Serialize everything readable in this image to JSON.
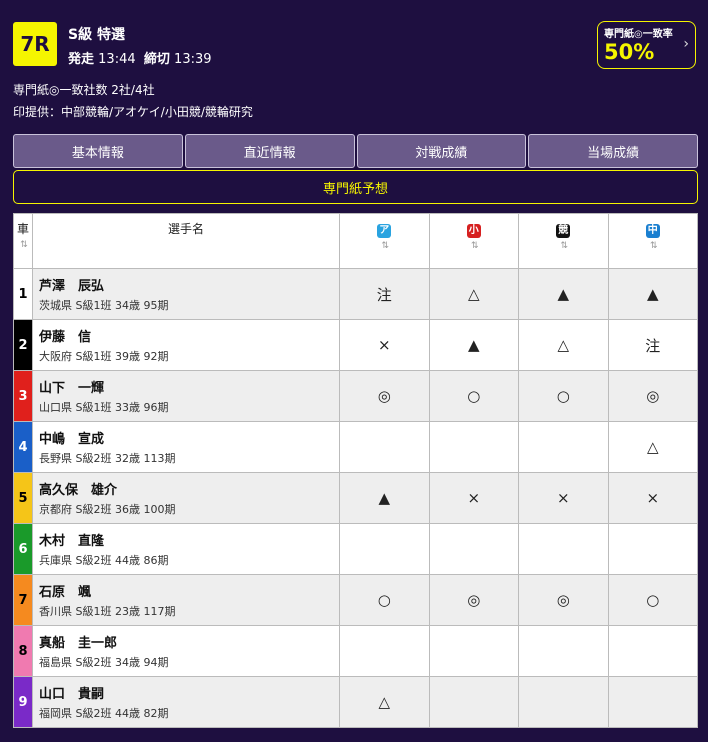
{
  "race": {
    "number": "7R",
    "class": "S級 特選",
    "start_label": "発走",
    "start_time": "13:44",
    "close_label": "締切",
    "close_time": "13:39"
  },
  "agreement": {
    "label": "専門紙◎一致率",
    "value": "50%"
  },
  "info": {
    "count": "専門紙◎一致社数 2社/4社",
    "sources": "印提供：中部競輪/アオケイ/小田競/競輪研究"
  },
  "tabs": [
    "基本情報",
    "直近情報",
    "対戦成績",
    "当場成績"
  ],
  "active_tab": "専門紙予想",
  "table": {
    "col_car": "車",
    "col_name": "選手名",
    "publishers": [
      {
        "icon_text": "ア",
        "color": "#29a3e0"
      },
      {
        "icon_text": "小",
        "color": "#d62020"
      },
      {
        "icon_text": "競",
        "color": "#111111"
      },
      {
        "icon_text": "中",
        "color": "#1a7fd0"
      }
    ],
    "rows": [
      {
        "car": "1",
        "bg": "#ffffff",
        "fg": "#000000",
        "name": "芦澤　辰弘",
        "meta": "茨城県 S級1班 34歳 95期",
        "marks": [
          "注",
          "△",
          "▲",
          "▲"
        ]
      },
      {
        "car": "2",
        "bg": "#000000",
        "fg": "#ffffff",
        "name": "伊藤　信",
        "meta": "大阪府 S級1班 39歳 92期",
        "marks": [
          "×",
          "▲",
          "△",
          "注"
        ]
      },
      {
        "car": "3",
        "bg": "#e0201c",
        "fg": "#ffffff",
        "name": "山下　一輝",
        "meta": "山口県 S級1班 33歳 96期",
        "marks": [
          "◎",
          "○",
          "○",
          "◎"
        ]
      },
      {
        "car": "4",
        "bg": "#1a5fc8",
        "fg": "#ffffff",
        "name": "中嶋　宣成",
        "meta": "長野県 S級2班 32歳 113期",
        "marks": [
          "",
          "",
          "",
          "△"
        ]
      },
      {
        "car": "5",
        "bg": "#f5c518",
        "fg": "#000000",
        "name": "高久保　雄介",
        "meta": "京都府 S級2班 36歳 100期",
        "marks": [
          "▲",
          "×",
          "×",
          "×"
        ]
      },
      {
        "car": "6",
        "bg": "#1a9a2a",
        "fg": "#ffffff",
        "name": "木村　直隆",
        "meta": "兵庫県 S級2班 44歳 86期",
        "marks": [
          "",
          "",
          "",
          ""
        ]
      },
      {
        "car": "7",
        "bg": "#f58a1f",
        "fg": "#000000",
        "name": "石原　颯",
        "meta": "香川県 S級1班 23歳 117期",
        "marks": [
          "○",
          "◎",
          "◎",
          "○"
        ]
      },
      {
        "car": "8",
        "bg": "#f07ab0",
        "fg": "#000000",
        "name": "真船　圭一郎",
        "meta": "福島県 S級2班 34歳 94期",
        "marks": [
          "",
          "",
          "",
          ""
        ]
      },
      {
        "car": "9",
        "bg": "#7a2ac8",
        "fg": "#ffffff",
        "name": "山口　貴嗣",
        "meta": "福岡県 S級2班 44歳 82期",
        "marks": [
          "△",
          "",
          "",
          ""
        ]
      }
    ]
  }
}
